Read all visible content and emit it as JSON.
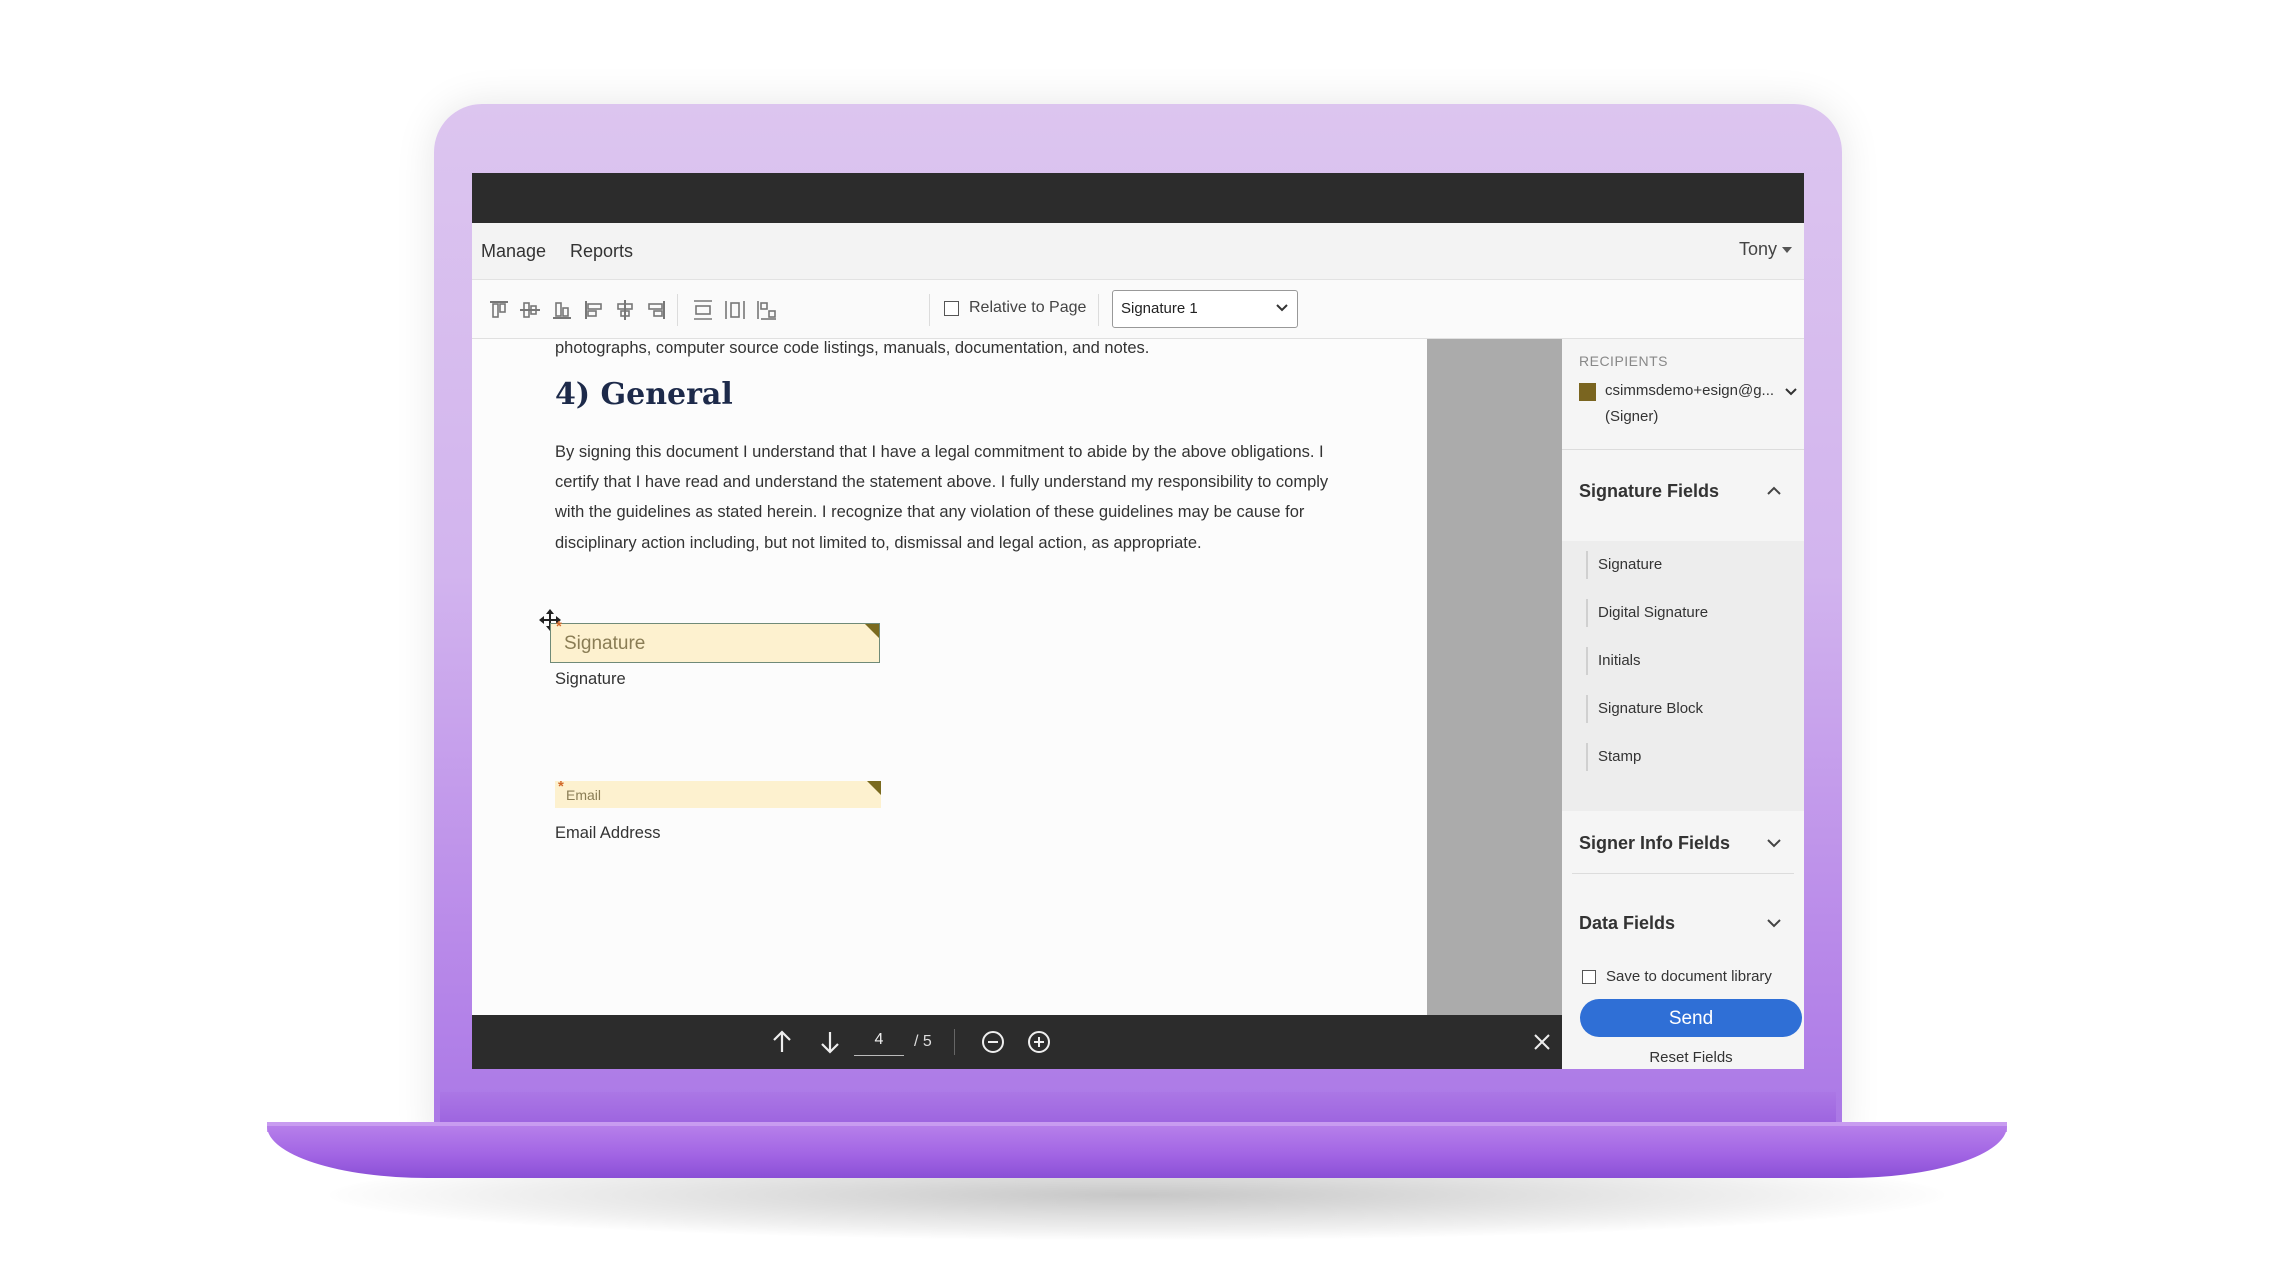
{
  "menu": {
    "manage": "Manage",
    "reports": "Reports",
    "user": "Tony"
  },
  "toolbar": {
    "relative_label": "Relative to Page",
    "relative_checked": false,
    "field_select_value": "Signature 1",
    "icons": [
      "align-top-icon",
      "align-middle-icon",
      "align-bottom-icon",
      "align-left-icon",
      "align-center-icon",
      "align-right-icon",
      "distribute-vertical-icon",
      "distribute-horizontal-icon",
      "match-size-icon"
    ]
  },
  "document": {
    "top_line": "photographs, computer source code listings, manuals, documentation, and notes.",
    "heading": "4) General",
    "paragraph_lines": [
      "By signing this document I understand that I have a legal commitment to abide by the above obligations. I",
      "certify that I have read and understand the statement above. I fully understand my responsibility to comply",
      "with the guidelines as stated herein. I recognize that any violation of these guidelines may be cause for",
      "disciplinary action including, but not limited to, dismissal and legal action, as appropriate."
    ],
    "signature_placeholder": "Signature",
    "signature_label": "Signature",
    "email_placeholder": "Email",
    "email_label": "Email Address"
  },
  "pager": {
    "current_page": "4",
    "total": "/ 5"
  },
  "panel": {
    "recipients_title": "RECIPIENTS",
    "recipient_email": "csimmsdemo+esign@g...",
    "recipient_role": "(Signer)",
    "recipient_color": "#7a6520",
    "signature_fields_title": "Signature Fields",
    "signature_fields": [
      "Signature",
      "Digital Signature",
      "Initials",
      "Signature Block",
      "Stamp"
    ],
    "signer_info_title": "Signer Info Fields",
    "data_fields_title": "Data Fields",
    "save_label": "Save to document library",
    "send_label": "Send",
    "reset_label": "Reset Fields"
  },
  "colors": {
    "accent": "#2f6fd6",
    "device": "#b98ae9",
    "field_bg": "#fdf1cf"
  }
}
